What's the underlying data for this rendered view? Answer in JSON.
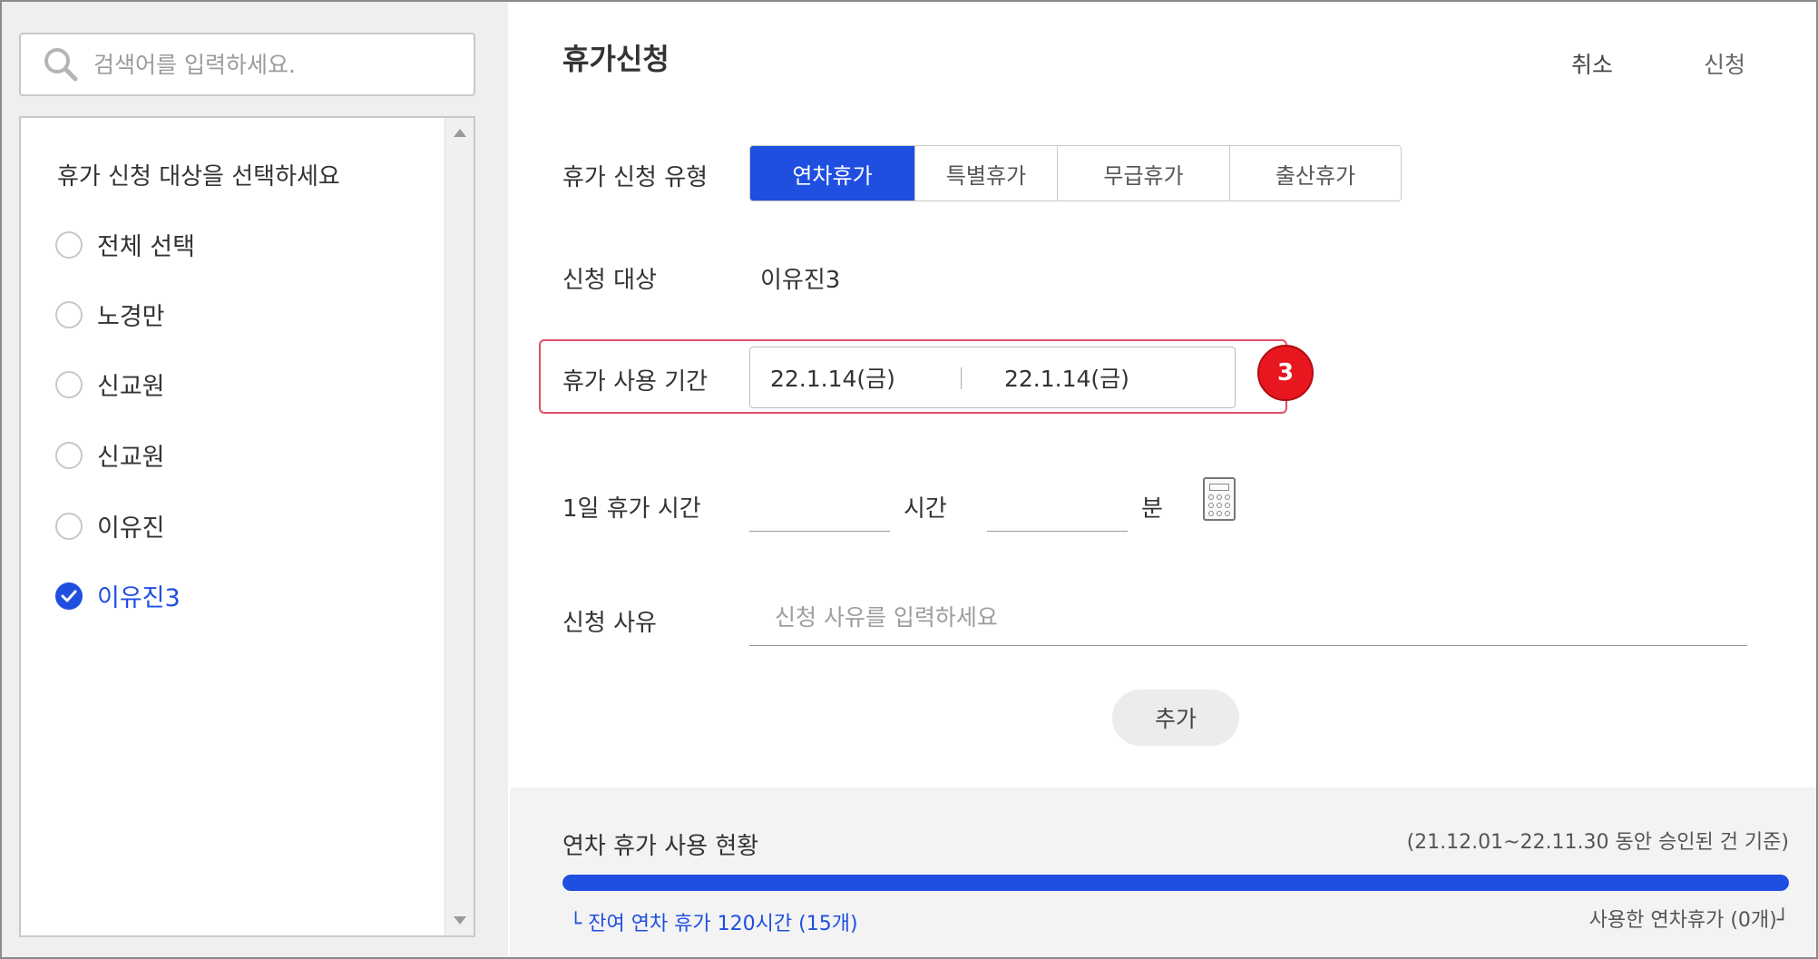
{
  "search": {
    "placeholder": "검색어를 입력하세요."
  },
  "target_list": {
    "title": "휴가 신청 대상을 선택하세요",
    "items": [
      {
        "label": "전체 선택",
        "checked": false
      },
      {
        "label": "노경만",
        "checked": false
      },
      {
        "label": "신교원",
        "checked": false
      },
      {
        "label": "신교원",
        "checked": false
      },
      {
        "label": "이유진",
        "checked": false
      },
      {
        "label": "이유진3",
        "checked": true
      }
    ]
  },
  "header": {
    "title": "휴가신청",
    "cancel": "취소",
    "apply": "신청"
  },
  "form": {
    "type_label": "휴가 신청 유형",
    "types": [
      "연차휴가",
      "특별휴가",
      "무급휴가",
      "출산휴가"
    ],
    "active_type": "연차휴가",
    "target_label": "신청 대상",
    "target_value": "이유진3",
    "period_label": "휴가 사용 기간",
    "start_date": "22.1.14(금)",
    "end_date": "22.1.14(금)",
    "badge": "3",
    "daily_label": "1일 휴가 시간",
    "hour_unit": "시간",
    "minute_unit": "분",
    "reason_label": "신청 사유",
    "reason_placeholder": "신청 사유를 입력하세요",
    "add_button": "추가"
  },
  "status": {
    "title": "연차 휴가 사용 현황",
    "basis": "(21.12.01~22.11.30 동안 승인된 건 기준)",
    "remaining": "└ 잔여 연차 휴가 120시간 (15개)",
    "used": "사용한 연차휴가 (0개)┘",
    "remaining_fraction": 1.0
  },
  "colors": {
    "accent": "#1f4fe0",
    "highlight_border": "#e0506a",
    "badge": "#e8161e"
  }
}
